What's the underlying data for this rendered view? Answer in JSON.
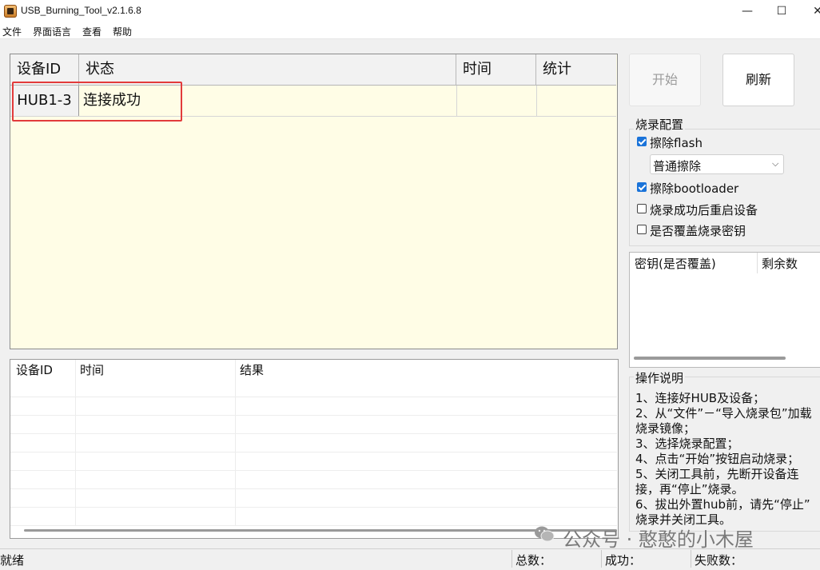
{
  "window": {
    "title": "USB_Burning_Tool_v2.1.6.8",
    "minimize": "—",
    "maximize": "☐",
    "close": "✕"
  },
  "menu": [
    "文件",
    "界面语言",
    "查看",
    "帮助"
  ],
  "main_table": {
    "columns": [
      "设备ID",
      "状态",
      "时间",
      "统计"
    ],
    "rows": [
      {
        "device_id": "HUB1-3",
        "status": "连接成功",
        "time": "",
        "stats": ""
      }
    ]
  },
  "log_table": {
    "columns": [
      "设备ID",
      "时间",
      "结果"
    ]
  },
  "status_bar": {
    "state": "就绪",
    "total": "总数：",
    "success": "成功：",
    "failed": "失败数："
  },
  "buttons": {
    "start": "开始",
    "refresh": "刷新"
  },
  "config": {
    "title": "烧录配置",
    "erase_flash": {
      "label": "擦除flash",
      "checked": true
    },
    "erase_mode": "普通擦除",
    "erase_bootloader": {
      "label": "擦除bootloader",
      "checked": true
    },
    "reboot_after": {
      "label": "烧录成功后重启设备",
      "checked": false
    },
    "overwrite_key": {
      "label": "是否覆盖烧录密钥",
      "checked": false
    }
  },
  "key_list": {
    "columns": [
      "密钥(是否覆盖)",
      "剩余数"
    ]
  },
  "instructions": {
    "title": "操作说明",
    "lines": [
      "1、连接好HUB及设备；",
      "2、从“文件”－“导入烧录包”加载",
      "烧录镜像；",
      "3、选择烧录配置；",
      "4、点击“开始”按钮启动烧录；",
      "5、关闭工具前，先断开设备连",
      "接，再“停止”烧录。",
      "6、拔出外置hub前，请先“停止”",
      "烧录并关闭工具。"
    ]
  },
  "watermark": "公众号 · 憨憨的小木屋",
  "colors": {
    "grid_background": "#fffde6",
    "highlight": "#e23b3b",
    "checkbox_checked": "#1a73d9"
  }
}
